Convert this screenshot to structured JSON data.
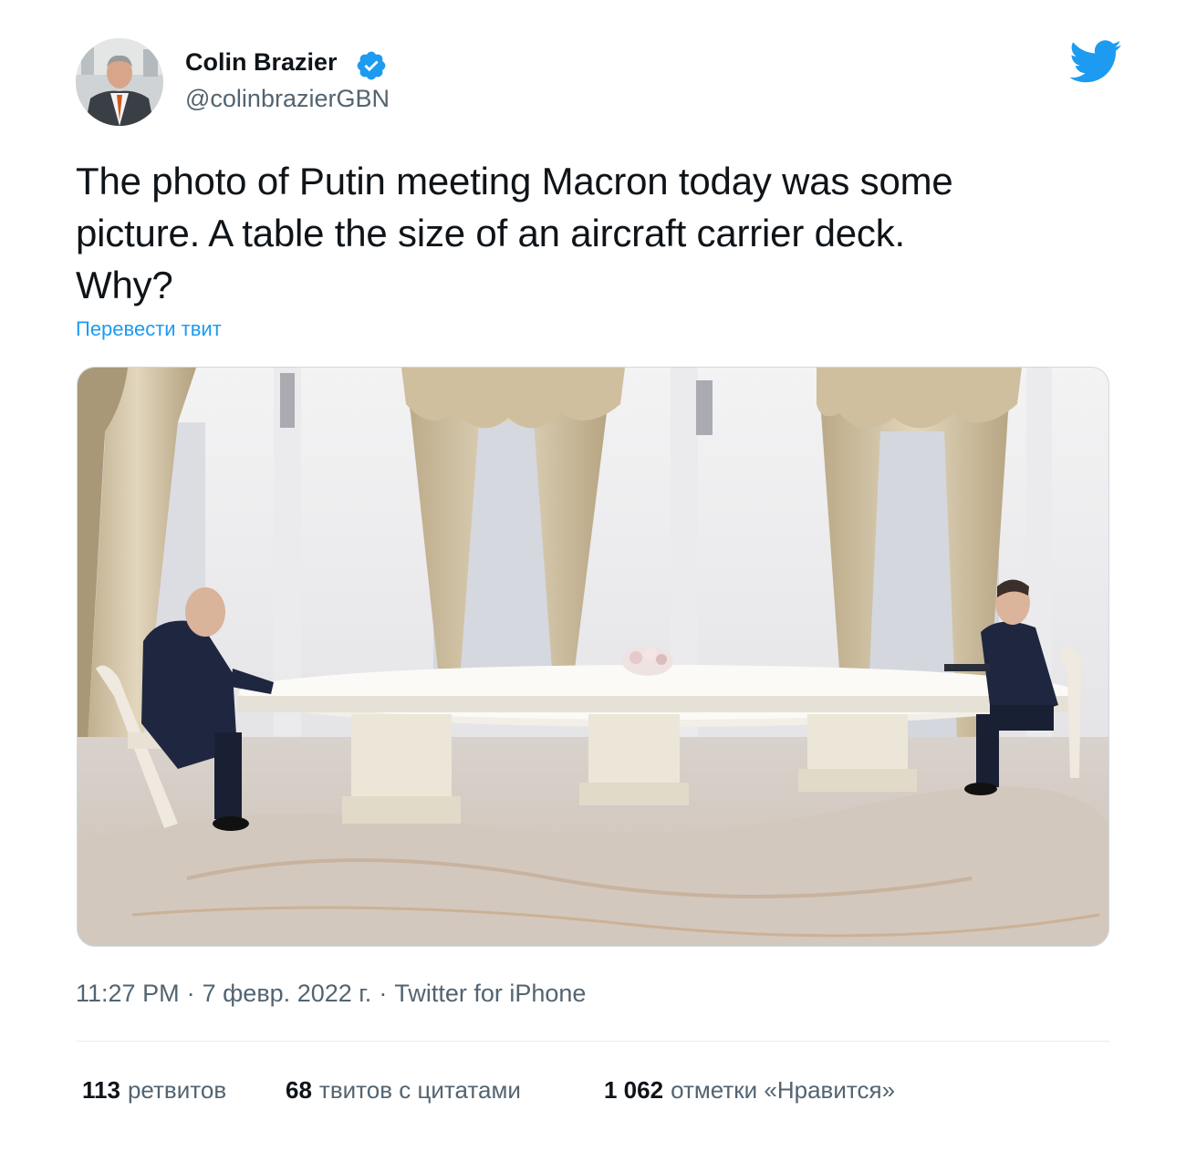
{
  "author": {
    "name": "Colin Brazier",
    "handle": "@colinbrazierGBN",
    "verified": true,
    "avatar_icon": "profile-photo"
  },
  "brand": {
    "logo_icon": "twitter-bird-icon",
    "color": "#1d9bf0"
  },
  "tweet": {
    "text_lines": [
      "The photo of Putin meeting Macron today was some",
      "picture. A table the size of an aircraft carrier deck.",
      "Why?"
    ],
    "translate_label": "Перевести твит"
  },
  "media": {
    "type": "photo"
  },
  "meta": {
    "time": "11:27 PM",
    "date": "7 февр. 2022 г.",
    "source": "Twitter for iPhone",
    "separator": "·"
  },
  "stats": [
    {
      "count": "113",
      "label": "ретвитов"
    },
    {
      "count": "68",
      "label": "твитов с цитатами"
    },
    {
      "count": "1 062",
      "label": "отметки «Нравится»"
    }
  ],
  "colors": {
    "text_primary": "#0f1419",
    "text_secondary": "#536471",
    "link": "#1d9bf0",
    "divider": "#e6ecf0"
  }
}
